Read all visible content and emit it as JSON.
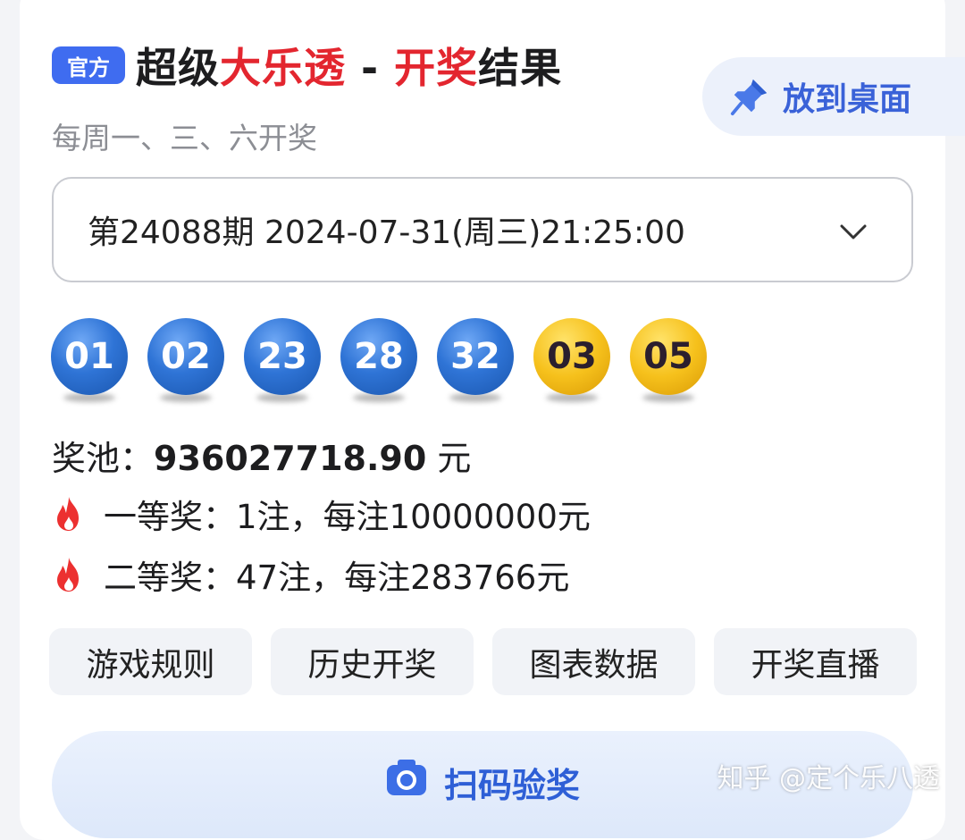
{
  "header": {
    "badge": "官方",
    "title_part1": "超级",
    "title_part2": "大乐透",
    "title_part3": " - ",
    "title_part4": "开奖",
    "title_part5": "结果",
    "subtitle": "每周一、三、六开奖",
    "pin_button": "放到桌面"
  },
  "draw_select": {
    "value": "第24088期 2024-07-31(周三)21:25:00"
  },
  "balls": {
    "front": [
      "01",
      "02",
      "23",
      "28",
      "32"
    ],
    "back": [
      "03",
      "05"
    ]
  },
  "pool": {
    "label": "奖池：",
    "amount": "936027718.90",
    "unit": " 元"
  },
  "prizes": [
    {
      "text": "一等奖：1注，每注10000000元"
    },
    {
      "text": "二等奖：47注，每注283766元"
    }
  ],
  "actions": [
    "游戏规则",
    "历史开奖",
    "图表数据",
    "开奖直播"
  ],
  "scan_button": "扫码验奖",
  "watermark": "知乎 @定个乐八透",
  "colors": {
    "accent_blue": "#3f6cf0",
    "red": "#e3262f",
    "ball_blue": "#2f74d6",
    "ball_gold": "#f6c11c"
  }
}
